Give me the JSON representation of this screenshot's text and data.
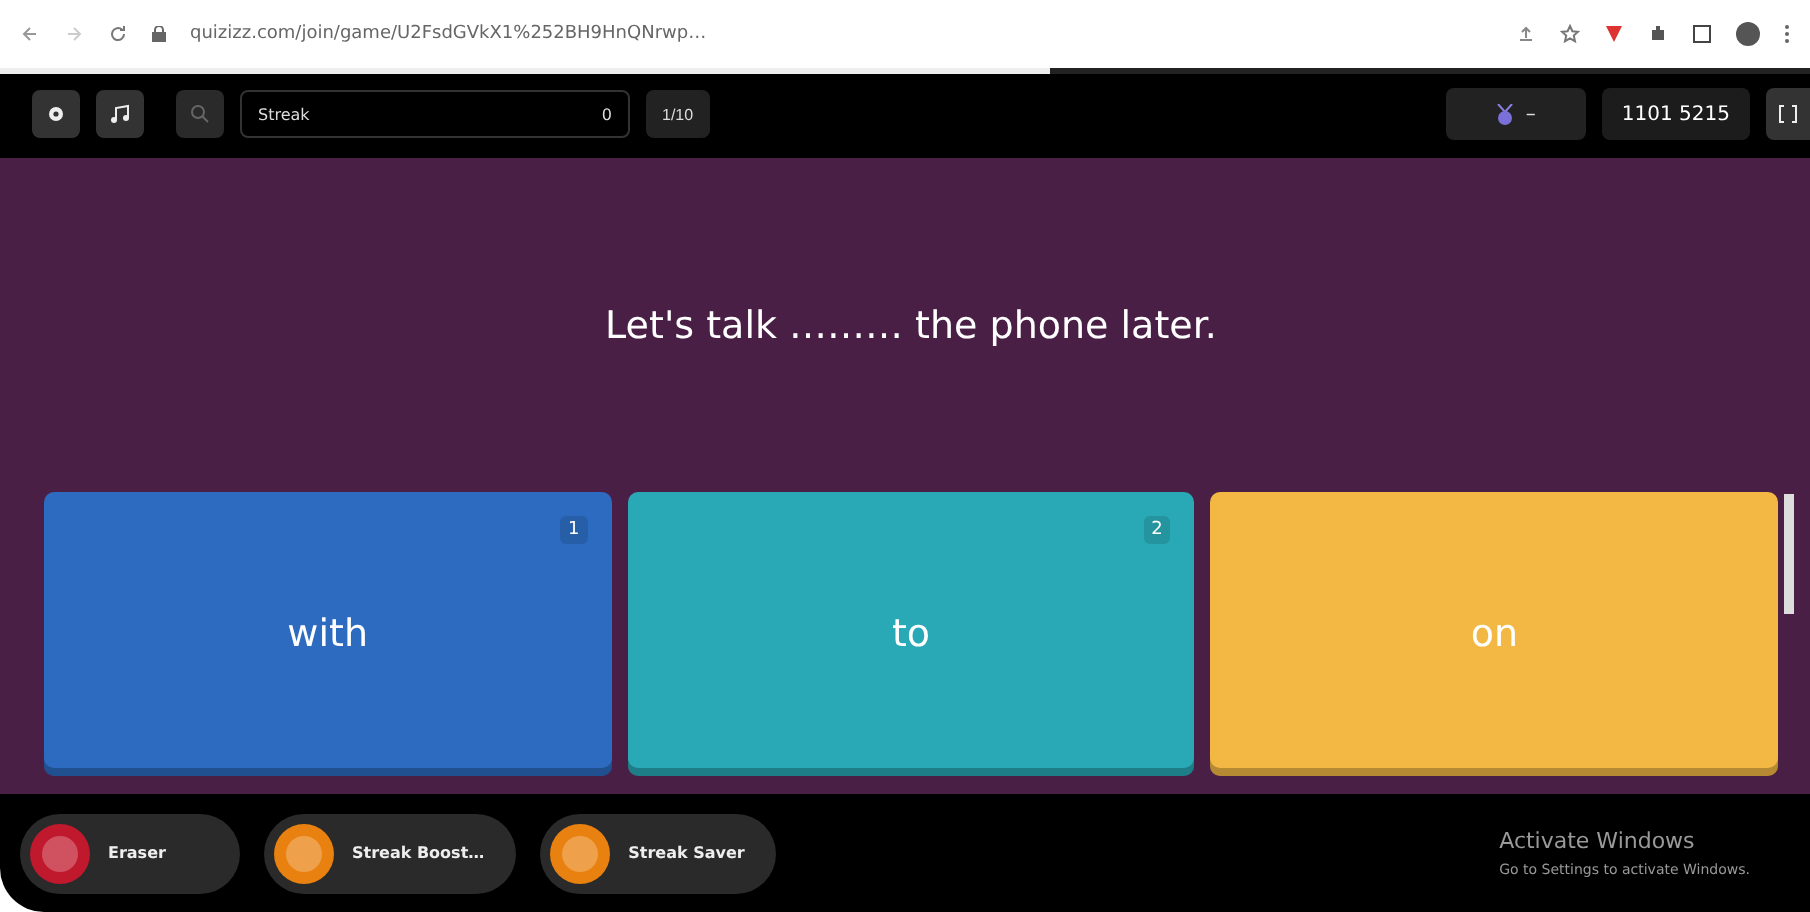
{
  "browser": {
    "url": "quizizz.com/join/game/U2FsdGVkX1%252BH9HnQNrwp…"
  },
  "toolbar": {
    "streak_label": "Streak",
    "streak_count": "0",
    "question_counter": "1/10",
    "score": "1101 5215",
    "rank": "–",
    "progress": {
      "level": 0.58
    }
  },
  "question": {
    "text": "Let's talk ……… the phone later."
  },
  "options": [
    {
      "text": "with",
      "number": "1",
      "color": "#2d6bc0"
    },
    {
      "text": "to",
      "number": "2",
      "color": "#29a9b5"
    },
    {
      "text": "on",
      "color": "#f2b843"
    }
  ],
  "powerups": [
    {
      "label": "Eraser",
      "color": "#c0182d"
    },
    {
      "label": "Streak Boost…",
      "color": "#e8810f"
    },
    {
      "label": "Streak Saver",
      "color": "#e8810f"
    }
  ],
  "watermark_notice": {
    "title": "Activate Windows",
    "subtitle": "Go to Settings to activate Windows."
  }
}
